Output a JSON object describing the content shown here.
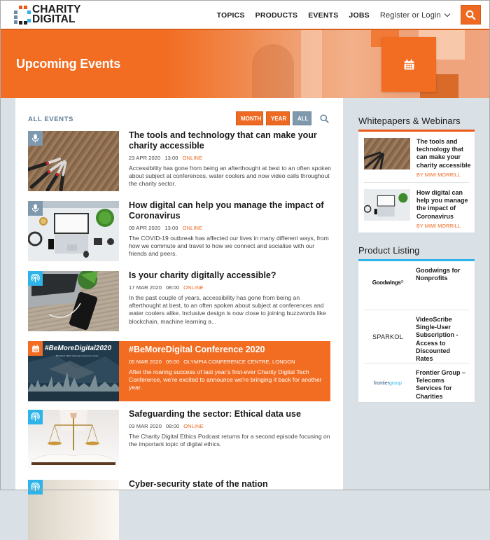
{
  "brand": {
    "line1": "CHARITY",
    "line2": "DIGITAL",
    "accent": "#f26d22",
    "blue": "#2eb4e8",
    "slate": "#7e98ae"
  },
  "nav": {
    "items": [
      "TOPICS",
      "PRODUCTS",
      "EVENTS",
      "JOBS"
    ],
    "login": "Register or Login",
    "search_icon": "search-icon"
  },
  "hero": {
    "title": "Upcoming Events",
    "icon": "calendar-icon"
  },
  "events_list": {
    "heading": "ALL EVENTS",
    "filters": [
      "MONTH",
      "YEAR",
      "ALL"
    ],
    "active_filter": "ALL",
    "items": [
      {
        "type": "webinar",
        "badge_icon": "microphone-icon",
        "title": "The tools and technology that can make your charity accessible",
        "date": "23 APR 2020",
        "time": "13:00",
        "location": "ONLINE",
        "description": "Accessibility has gone from being an afterthought at best to an often spoken about subject at conferences, water coolers and now video calls throughout the charity sector."
      },
      {
        "type": "webinar",
        "badge_icon": "microphone-icon",
        "title": "How digital can help you manage the impact of Coronavirus",
        "date": "09 APR 2020",
        "time": "13:00",
        "location": "ONLINE",
        "description": "The COVID-19 outbreak has affected our lives in many different ways, from how we commute and travel to how we connect and socialise with our friends and peers."
      },
      {
        "type": "podcast",
        "badge_icon": "podcast-icon",
        "title": "Is your charity digitally accessible?",
        "date": "17 MAR 2020",
        "time": "08:00",
        "location": "ONLINE",
        "description": "In the past couple of years, accessibility has gone from being an afterthought at best, to an often spoken about subject at conferences and water coolers alike. Inclusive design is now close to joining buzzwords like blockchain, machine learning a..."
      },
      {
        "type": "conference",
        "badge_icon": "calendar-icon",
        "featured": true,
        "thumb_text": "#BeMoreDigital2020",
        "thumb_subtext": "5th March 2020 | Olympia Conference Centre",
        "title": "#BeMoreDigital Conference 2020",
        "date": "05 MAR 2020",
        "time": "09:00",
        "location": "OLYMPIA CONFERENCE CENTRE, LONDON",
        "description": "After the roaring success of last year's first-ever Charity Digital Tech Conference, we're excited to announce we're bringing it back for another year."
      },
      {
        "type": "podcast",
        "badge_icon": "podcast-icon",
        "title": "Safeguarding the sector: Ethical data use",
        "date": "03 MAR 2020",
        "time": "08:00",
        "location": "ONLINE",
        "description": "The Charity Digital Ethics Podcast returns for a second episode focusing on the important topic of digital ethics."
      },
      {
        "type": "podcast",
        "badge_icon": "podcast-icon",
        "title": "Cyber-security state of the nation"
      }
    ]
  },
  "sidebar": {
    "whitepapers": {
      "heading": "Whitepapers & Webinars",
      "items": [
        {
          "title": "The tools and technology that can make your charity accessible",
          "author": "BY MIMI MORRILL"
        },
        {
          "title": "How digital can help you manage the impact of Coronavirus",
          "author": "BY MIMI MORRILL"
        }
      ]
    },
    "products": {
      "heading": "Product Listing",
      "items": [
        {
          "logo": "Goodwings",
          "logo_mark": "®",
          "title": "Goodwings for Nonprofits"
        },
        {
          "logo": "SPARKOL",
          "title": "VideoScribe Single-User Subscription - Access to Discounted Rates"
        },
        {
          "logo": "frontiergroup",
          "logo_a": "frontier",
          "logo_b": "group",
          "title": "Frontier Group – Telecoms Services for Charities"
        }
      ]
    }
  }
}
